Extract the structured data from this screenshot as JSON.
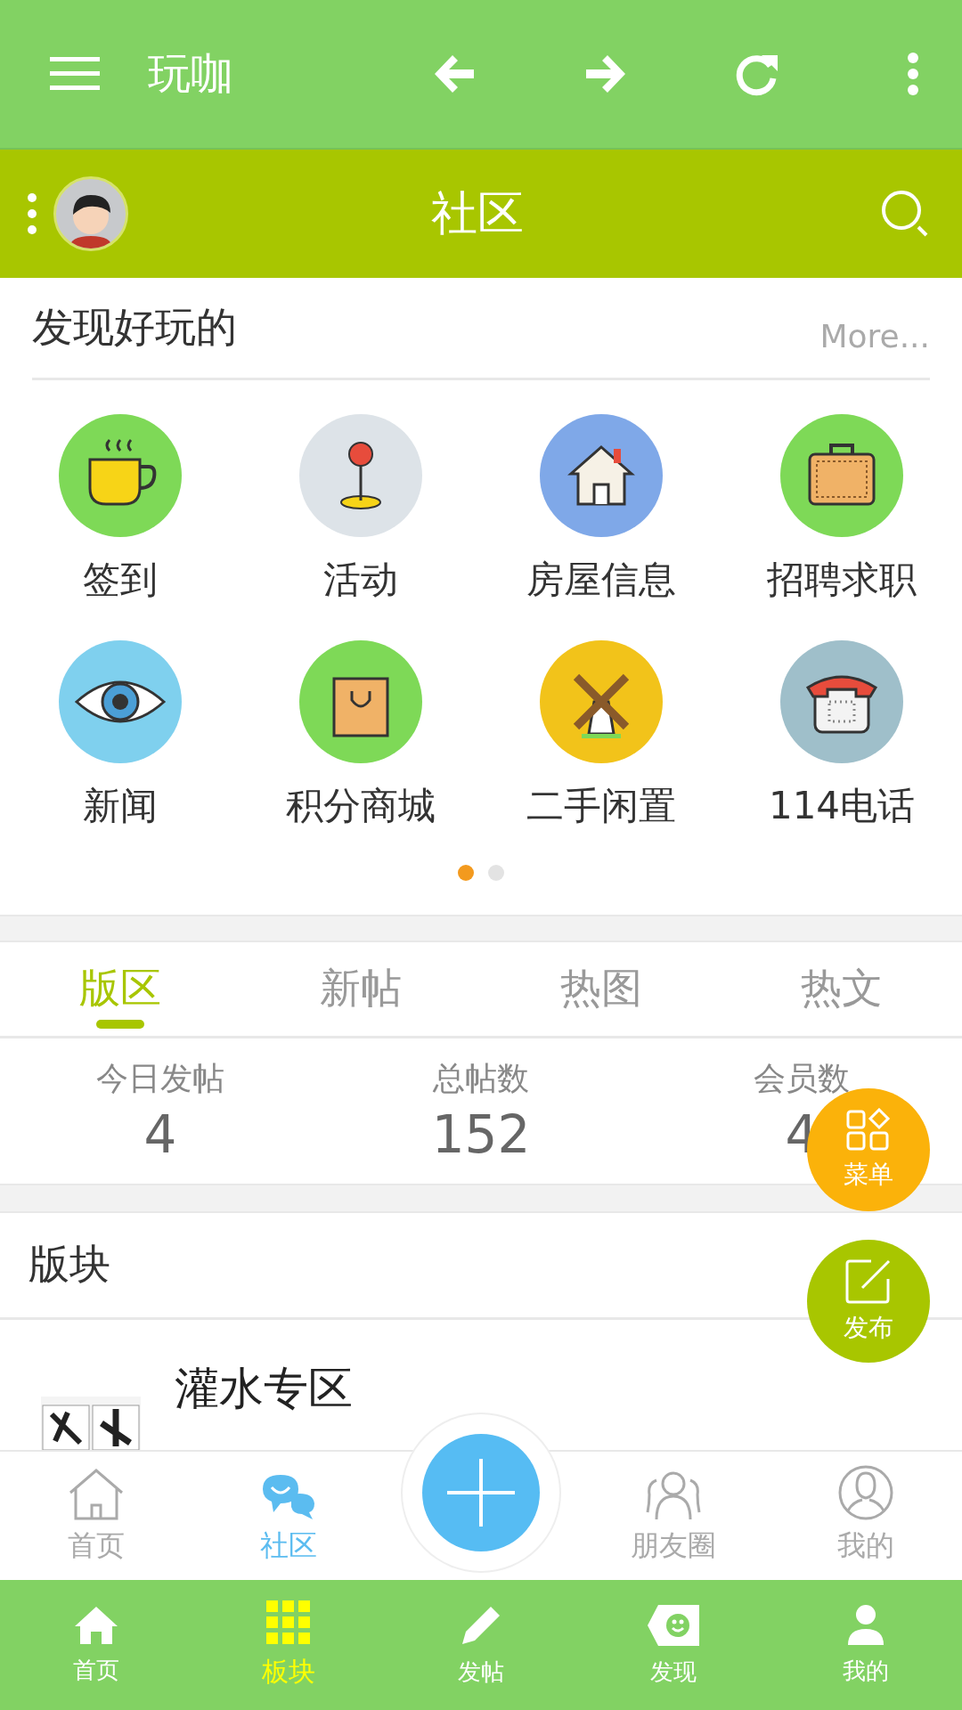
{
  "top_bar": {
    "title": "玩咖"
  },
  "header": {
    "title": "社区"
  },
  "discover": {
    "title": "发现好玩的",
    "more": "More...",
    "items": [
      {
        "label": "签到",
        "color": "#7ed957"
      },
      {
        "label": "活动",
        "color": "#dde3e8"
      },
      {
        "label": "房屋信息",
        "color": "#7fa8e8"
      },
      {
        "label": "招聘求职",
        "color": "#7ed957"
      },
      {
        "label": "新闻",
        "color": "#7fd0ee"
      },
      {
        "label": "积分商城",
        "color": "#7ed957"
      },
      {
        "label": "二手闲置",
        "color": "#f2c31a"
      },
      {
        "label": "114电话",
        "color": "#9fbfca"
      }
    ],
    "pager": [
      {
        "selected": true
      },
      {
        "selected": false
      }
    ]
  },
  "tabs": [
    {
      "label": "版区",
      "selected": true
    },
    {
      "label": "新帖",
      "selected": false
    },
    {
      "label": "热图",
      "selected": false
    },
    {
      "label": "热文",
      "selected": false
    }
  ],
  "stats": [
    {
      "label": "今日发帖",
      "value": "4"
    },
    {
      "label": "总帖数",
      "value": "152"
    },
    {
      "label": "会员数",
      "value": "4"
    }
  ],
  "section": {
    "title": "版块"
  },
  "forums": [
    {
      "name": "灌水专区"
    }
  ],
  "fabs": [
    {
      "kind": "menu",
      "label": "菜单"
    },
    {
      "kind": "publish",
      "label": "发布"
    }
  ],
  "bottom_nav": [
    {
      "kind": "tab",
      "label": "首页",
      "selected": false
    },
    {
      "kind": "tab",
      "label": "社区",
      "selected": true
    },
    {
      "kind": "add"
    },
    {
      "kind": "tab",
      "label": "朋友圈",
      "selected": false
    },
    {
      "kind": "tab",
      "label": "我的",
      "selected": false
    }
  ],
  "tab_bar": [
    {
      "label": "首页",
      "selected": false
    },
    {
      "label": "板块",
      "selected": true
    },
    {
      "label": "发帖",
      "selected": false
    },
    {
      "label": "发现",
      "selected": false
    },
    {
      "label": "我的",
      "selected": false
    }
  ]
}
